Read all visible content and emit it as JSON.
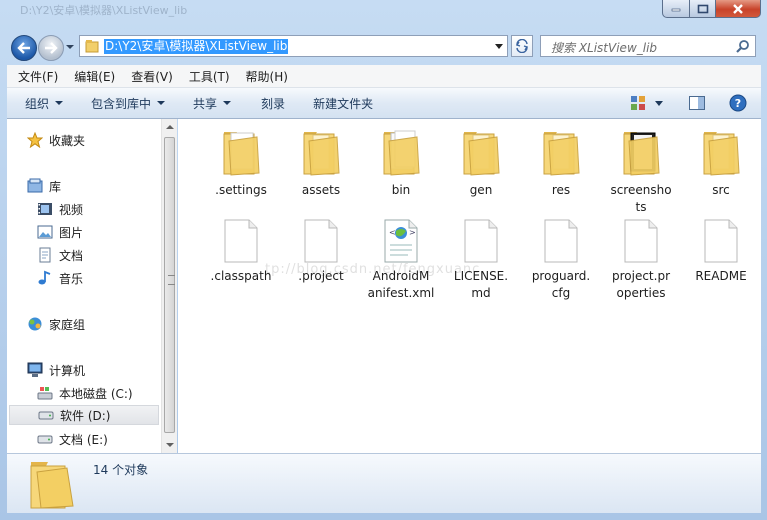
{
  "window": {
    "caption_ghost": "D:\\Y2\\安卓\\模拟器\\XListView_lib",
    "minimize_label": "",
    "maximize_label": "",
    "close_label": ""
  },
  "address": {
    "path": "D:\\Y2\\安卓\\模拟器\\XListView_lib",
    "search_placeholder": "搜索 XListView_lib"
  },
  "menu": [
    "文件(F)",
    "编辑(E)",
    "查看(V)",
    "工具(T)",
    "帮助(H)"
  ],
  "toolbar": {
    "organize": "组织",
    "include": "包含到库中",
    "share": "共享",
    "burn": "刻录",
    "new_folder": "新建文件夹"
  },
  "nav": {
    "favorites": "收藏夹",
    "libraries": "库",
    "videos": "视频",
    "pictures": "图片",
    "documents": "文档",
    "music": "音乐",
    "homegroup": "家庭组",
    "computer": "计算机",
    "drive_c": "本地磁盘 (C:)",
    "drive_d": "软件 (D:)",
    "drive_e": "文档 (E:)"
  },
  "items": [
    {
      "name": ".settings",
      "kind": "folder-doc"
    },
    {
      "name": "assets",
      "kind": "folder"
    },
    {
      "name": "bin",
      "kind": "folder-open"
    },
    {
      "name": "gen",
      "kind": "folder"
    },
    {
      "name": "res",
      "kind": "folder"
    },
    {
      "name": "screenshots",
      "kind": "folder-dark"
    },
    {
      "name": "src",
      "kind": "folder"
    },
    {
      "name": ".classpath",
      "kind": "file"
    },
    {
      "name": ".project",
      "kind": "file"
    },
    {
      "name": "AndroidManifest.xml",
      "kind": "xml"
    },
    {
      "name": "LICENSE.md",
      "kind": "file"
    },
    {
      "name": "proguard.cfg",
      "kind": "file"
    },
    {
      "name": "project.properties",
      "kind": "file"
    },
    {
      "name": "README",
      "kind": "file"
    }
  ],
  "item_display": [
    ".settings",
    "assets",
    "bin",
    "gen",
    "res",
    "screensho\nts",
    "src",
    ".classpath",
    ".project",
    "AndroidM\nanifest.xml",
    "LICENSE.\nmd",
    "proguard.\ncfg",
    "project.pr\noperties",
    "README"
  ],
  "watermark": "tp://blog.csdn.net/fengxuanc",
  "status": {
    "count": "14 个对象"
  },
  "colors": {
    "selection": "#3399ff",
    "folder": "#f2cf6a",
    "command_text": "#1e395b"
  }
}
